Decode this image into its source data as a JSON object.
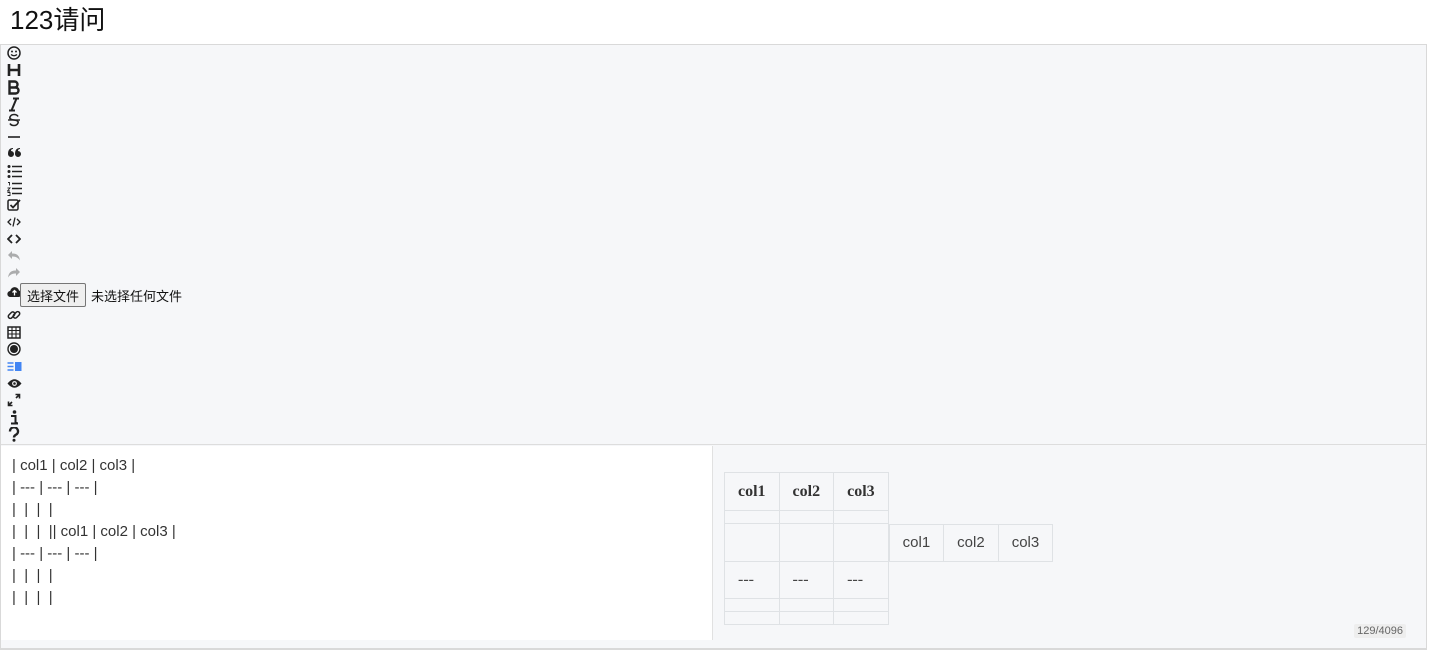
{
  "page": {
    "title": "123请问"
  },
  "toolbar": {
    "tools": [
      {
        "name": "emoji-icon",
        "disabled": false
      },
      {
        "name": "heading-icon",
        "disabled": false
      },
      {
        "name": "bold-icon",
        "disabled": false
      },
      {
        "name": "italic-icon",
        "disabled": false
      },
      {
        "name": "strikethrough-icon",
        "disabled": false
      },
      {
        "name": "horizontal-rule-icon",
        "disabled": false
      },
      {
        "name": "quote-icon",
        "disabled": false
      },
      {
        "name": "unordered-list-icon",
        "disabled": false
      },
      {
        "name": "ordered-list-icon",
        "disabled": false
      },
      {
        "name": "checklist-icon",
        "disabled": false
      },
      {
        "name": "code-icon",
        "disabled": false
      },
      {
        "name": "inline-code-icon",
        "disabled": false
      },
      {
        "name": "undo-icon",
        "disabled": true
      },
      {
        "name": "redo-icon",
        "disabled": true
      },
      {
        "name": "upload-icon",
        "disabled": false
      },
      {
        "name": "link-icon",
        "disabled": false
      },
      {
        "name": "table-icon",
        "disabled": false
      },
      {
        "name": "record-icon",
        "disabled": false
      },
      {
        "name": "both-panes-icon",
        "disabled": false
      },
      {
        "name": "preview-icon",
        "disabled": false
      },
      {
        "name": "fullscreen-icon",
        "disabled": false
      },
      {
        "name": "info-icon",
        "disabled": false
      },
      {
        "name": "help-icon",
        "disabled": false
      }
    ],
    "accent_color": "#4285f4",
    "file_input": {
      "button_label": "选择文件",
      "status": "未选择任何文件"
    }
  },
  "editor": {
    "text": "| col1 | col2 | col3 |\n| --- | --- | --- |\n|  |  |  |\n|  |  |  || col1 | col2 | col3 |\n| --- | --- | --- |\n|  |  |  |\n|  |  |  |",
    "counter": "129/4096"
  },
  "preview": {
    "headers": [
      "col1",
      "col2",
      "col3"
    ],
    "nested_cells": [
      "col1",
      "col2",
      "col3"
    ],
    "dash_cells": [
      "---",
      "---",
      "---"
    ]
  }
}
